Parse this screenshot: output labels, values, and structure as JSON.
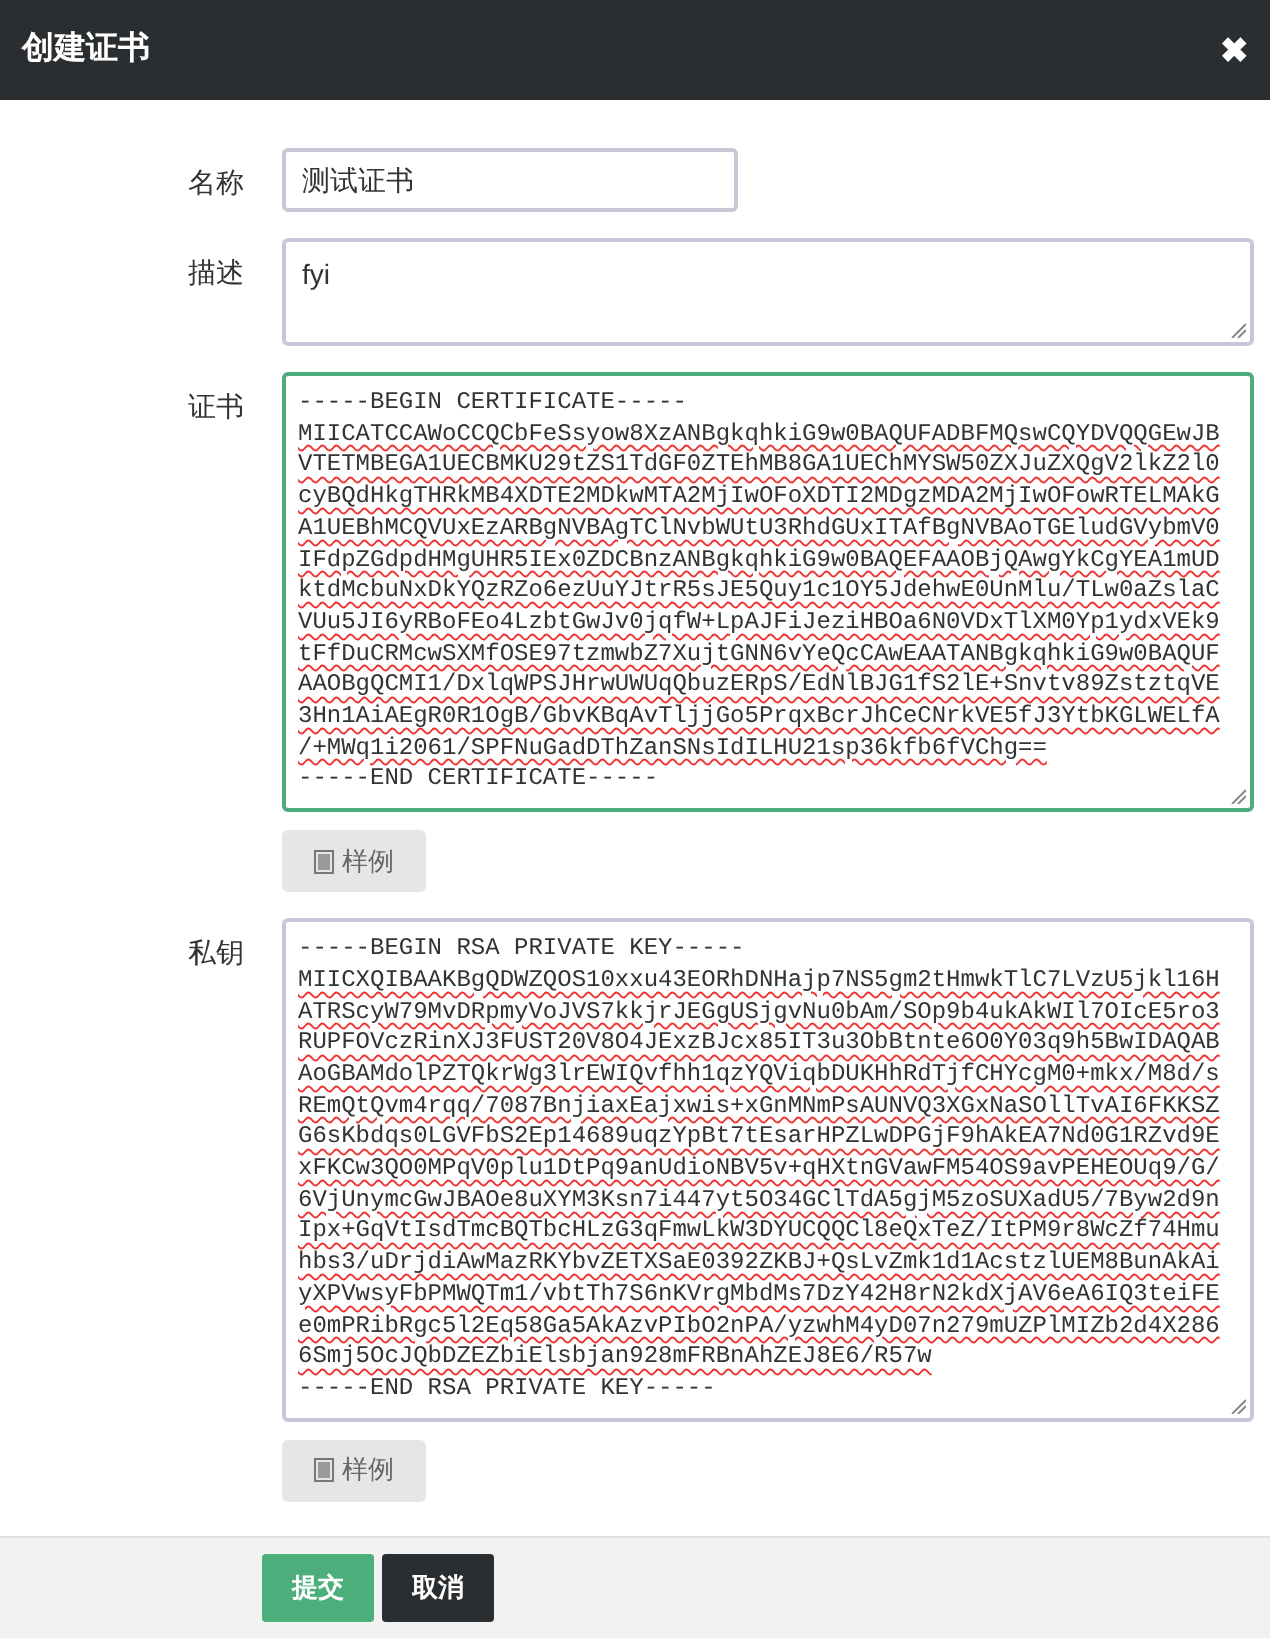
{
  "dialog": {
    "title": "创建证书",
    "close": "✖"
  },
  "fields": [
    {
      "label": "名称",
      "kind": "input",
      "value": "测试证书",
      "focused": false
    },
    {
      "label": "描述",
      "kind": "textarea",
      "value": "fyi",
      "focused": false
    },
    {
      "label": "证书",
      "kind": "code",
      "focused": true,
      "sample_button": "样例",
      "value_lines": [
        "-----BEGIN CERTIFICATE-----",
        "MIICATCCAWoCCQCbFeSsyow8XzANBgkqhkiG9w0BAQUFADBFMQswCQYDVQQGEwJB",
        "VTETMBEGA1UECBMKU29tZS1TdGF0ZTEhMB8GA1UEChMYSW50ZXJuZXQgV2lkZ2l0",
        "cyBQdHkgTHRkMB4XDTE2MDkwMTA2MjIwOFoXDTI2MDgzMDA2MjIwOFowRTELMAkG",
        "A1UEBhMCQVUxEzARBgNVBAgTClNvbWUtU3RhdGUxITAfBgNVBAoTGEludGVybmV0",
        "IFdpZGdpdHMgUHR5IEx0ZDCBnzANBgkqhkiG9w0BAQEFAAOBjQAwgYkCgYEA1mUD",
        "ktdMcbuNxDkYQzRZo6ezUuYJtrR5sJE5Quy1c1OY5JdehwE0UnMlu/TLw0aZslaC",
        "VUu5JI6yRBoFEo4LzbtGwJv0jqfW+LpAJFiJeziHBOa6N0VDxTlXM0Yp1ydxVEk9",
        "tFfDuCRMcwSXMfOSE97tzmwbZ7XujtGNN6vYeQcCAwEAATANBgkqhkiG9w0BAQUF",
        "AAOBgQCMI1/DxlqWPSJHrwUWUqQbuzERpS/EdNlBJG1fS2lE+Snvtv89ZstztqVE",
        "3Hn1AiAEgR0R1OgB/GbvKBqAvTljjGo5PrqxBcrJhCeCNrkVE5fJ3YtbKGLWELfA",
        "/+MWq1i2061/SPFNuGadDThZanSNsIdILHU21sp36kfb6fVChg==",
        "-----END CERTIFICATE-----"
      ]
    },
    {
      "label": "私钥",
      "kind": "code",
      "focused": false,
      "sample_button": "样例",
      "value_lines": [
        "-----BEGIN RSA PRIVATE KEY-----",
        "MIICXQIBAAKBgQDWZQOS10xxu43EORhDNHajp7NS5gm2tHmwkTlC7LVzU5jkl16H",
        "ATRScyW79MvDRpmyVoJVS7kkjrJEGgUSjgvNu0bAm/SOp9b4ukAkWIl7OIcE5ro3",
        "RUPFOVczRinXJ3FUST20V8O4JExzBJcx85IT3u3ObBtnte6O0Y03q9h5BwIDAQAB",
        "AoGBAMdolPZTQkrWg3lrEWIQvfhh1qzYQViqbDUKHhRdTjfCHYcgM0+mkx/M8d/s",
        "REmQtQvm4rqq/7087BnjiaxEajxwis+xGnMNmPsAUNVQ3XGxNaSOllTvAI6FKKSZ",
        "G6sKbdqs0LGVFbS2Ep14689uqzYpBt7tEsarHPZLwDPGjF9hAkEA7Nd0G1RZvd9E",
        "xFKCw3QO0MPqV0plu1DtPq9anUdioNBV5v+qHXtnGVawFM54OS9avPEHEOUq9/G/",
        "6VjUnymcGwJBAOe8uXYM3Ksn7i447yt5O34GClTdA5gjM5zoSUXadU5/7Byw2d9n",
        "Ipx+GqVtIsdTmcBQTbcHLzG3qFmwLkW3DYUCQQCl8eQxTeZ/ItPM9r8WcZf74Hmu",
        "hbs3/uDrjdiAwMazRKYbvZETXSaE0392ZKBJ+QsLvZmk1d1AcstzlUEM8BunAkAi",
        "yXPVwsyFbPMWQTm1/vbtTh7S6nKVrgMbdMs7DzY42H8rN2kdXjAV6eA6IQ3teiFE",
        "e0mPRibRgc5l2Eq58Ga5AkAzvPIbO2nPA/yzwhM4yD07n279mUZPlMIZb2d4X286",
        "6Smj5OcJQbDZEZbiElsbjan928mFRBnAhZEJ8E6/R57w",
        "-----END RSA PRIVATE KEY-----"
      ]
    }
  ],
  "footer": {
    "buttons": [
      {
        "label": "提交",
        "kind": "primary"
      },
      {
        "label": "取消",
        "kind": "secondary"
      }
    ]
  }
}
